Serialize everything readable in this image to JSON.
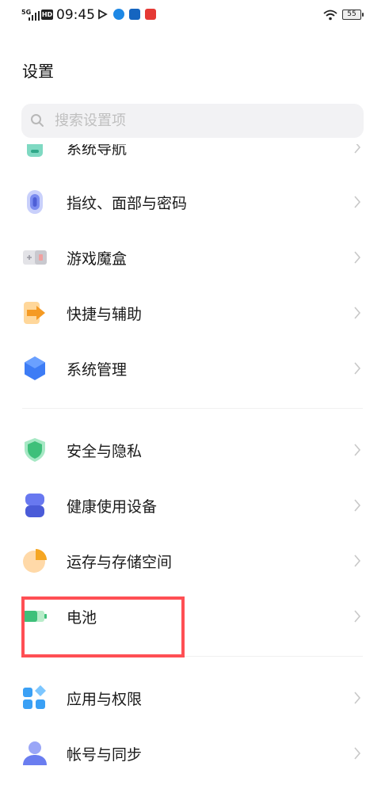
{
  "status_bar": {
    "network": "5G",
    "hd": "HD",
    "time": "09:45",
    "battery": "55"
  },
  "page": {
    "title": "设置"
  },
  "search": {
    "placeholder": "搜索设置项"
  },
  "items": [
    {
      "label": "系统导航",
      "icon": "navigation-icon"
    },
    {
      "label": "指纹、面部与密码",
      "icon": "fingerprint-icon"
    },
    {
      "label": "游戏魔盒",
      "icon": "gamepad-icon"
    },
    {
      "label": "快捷与辅助",
      "icon": "shortcut-arrow-icon"
    },
    {
      "label": "系统管理",
      "icon": "hexagon-icon"
    },
    {
      "label": "安全与隐私",
      "icon": "shield-icon"
    },
    {
      "label": "健康使用设备",
      "icon": "hourglass-icon"
    },
    {
      "label": "运存与存储空间",
      "icon": "pie-chart-icon"
    },
    {
      "label": "电池",
      "icon": "battery-icon"
    },
    {
      "label": "应用与权限",
      "icon": "apps-grid-icon"
    },
    {
      "label": "帐号与同步",
      "icon": "user-icon"
    }
  ],
  "colors": {
    "highlight": "#ff4f54",
    "fingerprint": "#7b8cf0",
    "shortcut": "#f5a623",
    "system_hex": "#3d7cf5",
    "shield": "#3ec07a",
    "health": "#5a6ee8",
    "storage": "#f5a623",
    "battery": "#3ec07a",
    "apps": "#3aa0f5",
    "account": "#6a7df0"
  }
}
